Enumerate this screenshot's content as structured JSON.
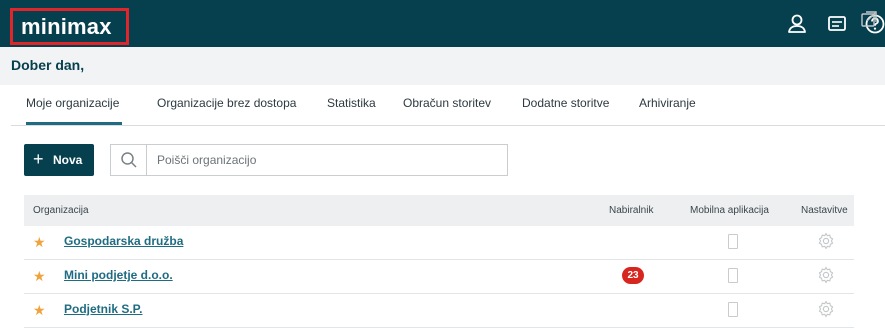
{
  "header": {
    "logo_text": "minimax",
    "icons": [
      "user-icon",
      "messages-icon",
      "help-icon"
    ]
  },
  "greeting": "Dober dan,",
  "tabs": [
    {
      "label": "Moje organizacije",
      "active": true
    },
    {
      "label": "Organizacije brez dostopa",
      "active": false
    },
    {
      "label": "Statistika",
      "active": false
    },
    {
      "label": "Obračun storitev",
      "active": false
    },
    {
      "label": "Dodatne storitve",
      "active": false
    },
    {
      "label": "Arhiviranje",
      "active": false
    }
  ],
  "toolbar": {
    "new_label": "Nova",
    "search_placeholder": "Poišči organizacijo"
  },
  "table": {
    "columns": [
      "Organizacija",
      "Nabiralnik",
      "Mobilna aplikacija",
      "Nastavitve"
    ],
    "rows": [
      {
        "name": "Gospodarska družba",
        "mailbox": ""
      },
      {
        "name": "Mini podjetje d.o.o.",
        "mailbox": "23"
      },
      {
        "name": "Podjetnik S.P.",
        "mailbox": ""
      }
    ]
  },
  "colors": {
    "topbar": "#06404f",
    "accent": "#1f6c82",
    "star": "#f0a33c",
    "badge": "#d7261e",
    "highlight_box": "#e0262b"
  }
}
